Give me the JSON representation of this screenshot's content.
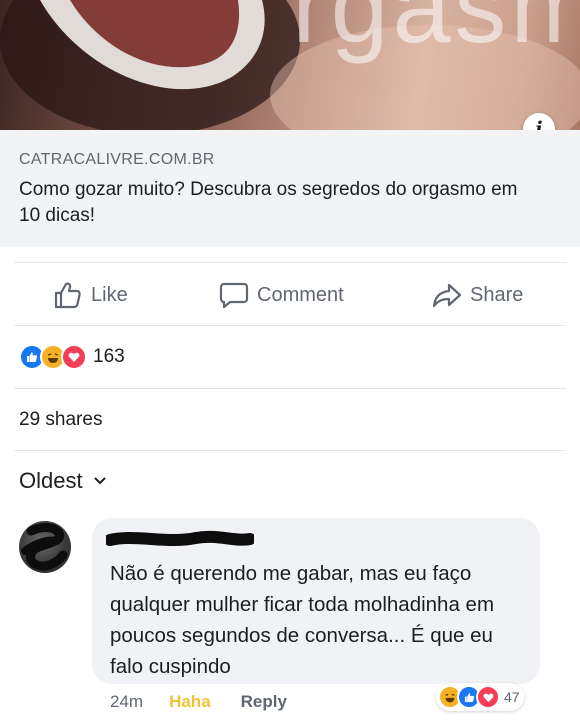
{
  "preview": {
    "image_overlay_text": "rgasm",
    "info_icon": "info-icon"
  },
  "link": {
    "domain": "CATRACALIVRE.COM.BR",
    "title": "Como gozar muito? Descubra os segredos do orgasmo em 10 dicas!"
  },
  "actions": {
    "like_label": "Like",
    "comment_label": "Comment",
    "share_label": "Share"
  },
  "reactions": {
    "icons": [
      "like-icon",
      "haha-icon",
      "love-icon"
    ],
    "count": "163"
  },
  "shares": "29 shares",
  "sort": {
    "label": "Oldest"
  },
  "comment": {
    "text": "Não é querendo me gabar, mas eu faço qualquer mulher ficar toda molhadinha em poucos segundos de conversa... É que eu falo cuspindo",
    "time": "24m",
    "haha_label": "Haha",
    "reply_label": "Reply",
    "reaction_icons": [
      "haha-icon",
      "like-icon",
      "love-icon"
    ],
    "reaction_count": "47"
  },
  "colors": {
    "like": "#1877f2",
    "haha": "#f7b125",
    "love": "#f33e58",
    "link_card_bg": "#f2f3f5",
    "secondary_text": "#606770"
  }
}
